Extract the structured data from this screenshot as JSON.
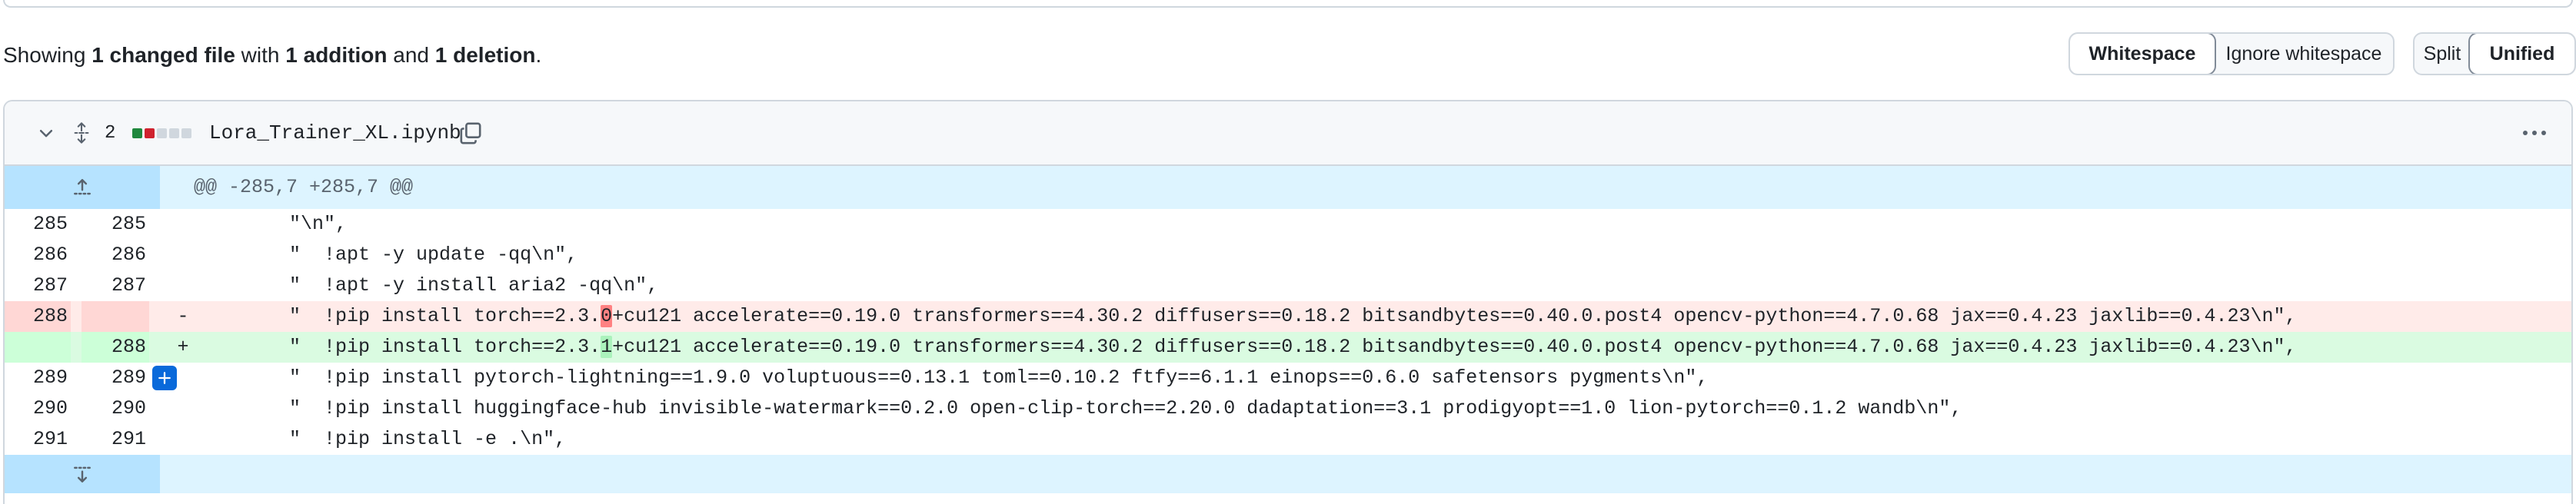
{
  "summary": {
    "prefix": "Showing ",
    "files": "1 changed file",
    "mid1": " with ",
    "additions": "1 addition",
    "mid2": " and ",
    "deletions": "1 deletion",
    "suffix": "."
  },
  "whitespace_toggle": {
    "options": [
      "Whitespace",
      "Ignore whitespace"
    ],
    "selected": "Whitespace"
  },
  "view_toggle": {
    "options": [
      "Split",
      "Unified"
    ],
    "selected": "Unified"
  },
  "file": {
    "change_count": "2",
    "name": "Lora_Trainer_XL.ipynb",
    "diffstat_colors": [
      "#1f883d",
      "#cf222e",
      "#d0d7de",
      "#d0d7de",
      "#d0d7de"
    ]
  },
  "hunk_header": "@@ -285,7 +285,7 @@",
  "lines": [
    {
      "type": "ctx",
      "old": "285",
      "new": "285",
      "code": "        \"\\n\","
    },
    {
      "type": "ctx",
      "old": "286",
      "new": "286",
      "code": "        \"  !apt -y update -qq\\n\","
    },
    {
      "type": "ctx",
      "old": "287",
      "new": "287",
      "code": "        \"  !apt -y install aria2 -qq\\n\","
    },
    {
      "type": "del",
      "old": "288",
      "new": "",
      "sign": "-",
      "pre": "        \"  !pip install torch==2.3.",
      "hl": "0",
      "post": "+cu121 accelerate==0.19.0 transformers==4.30.2 diffusers==0.18.2 bitsandbytes==0.40.0.post4 opencv-python==4.7.0.68 jax==0.4.23 jaxlib==0.4.23\\n\","
    },
    {
      "type": "add",
      "old": "",
      "new": "288",
      "sign": "+",
      "pre": "        \"  !pip install torch==2.3.",
      "hl": "1",
      "post": "+cu121 accelerate==0.19.0 transformers==4.30.2 diffusers==0.18.2 bitsandbytes==0.40.0.post4 opencv-python==4.7.0.68 jax==0.4.23 jaxlib==0.4.23\\n\","
    },
    {
      "type": "ctx",
      "old": "289",
      "new": "289",
      "code": "        \"  !pip install pytorch-lightning==1.9.0 voluptuous==0.13.1 toml==0.10.2 ftfy==6.1.1 einops==0.6.0 safetensors pygments\\n\","
    },
    {
      "type": "ctx",
      "old": "290",
      "new": "290",
      "code": "        \"  !pip install huggingface-hub invisible-watermark==0.2.0 open-clip-torch==2.20.0 dadaptation==3.1 prodigyopt==1.0 lion-pytorch==0.1.2 wandb\\n\","
    },
    {
      "type": "ctx",
      "old": "291",
      "new": "291",
      "code": "        \"  !pip install -e .\\n\","
    }
  ]
}
